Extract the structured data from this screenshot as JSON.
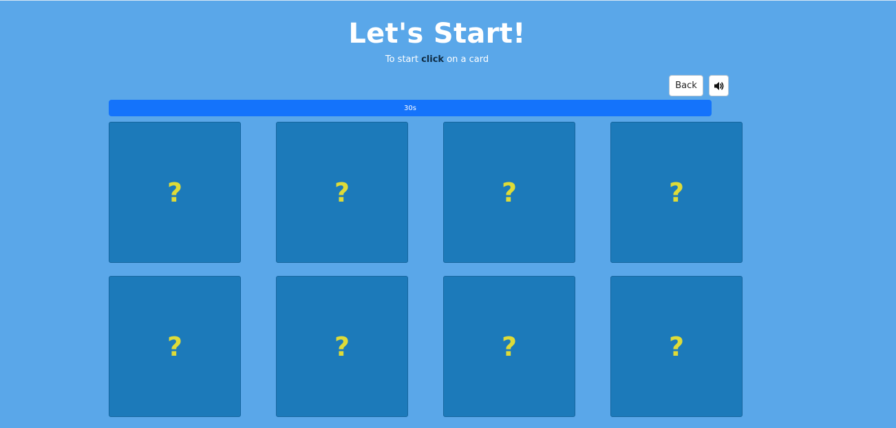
{
  "header": {
    "title": "Let's Start!",
    "subtitle_before": "To start ",
    "subtitle_emphasis": "click",
    "subtitle_after": " on a card"
  },
  "controls": {
    "back_label": "Back",
    "sound_icon": "speaker-volume-icon"
  },
  "timer": {
    "label": "30s",
    "percent": 100
  },
  "cards": [
    {
      "face": "?"
    },
    {
      "face": "?"
    },
    {
      "face": "?"
    },
    {
      "face": "?"
    },
    {
      "face": "?"
    },
    {
      "face": "?"
    },
    {
      "face": "?"
    },
    {
      "face": "?"
    }
  ],
  "colors": {
    "background": "#5aa7e9",
    "card": "#1c7aba",
    "card_mark": "#dedb38",
    "timer_bar": "#1473fb"
  }
}
